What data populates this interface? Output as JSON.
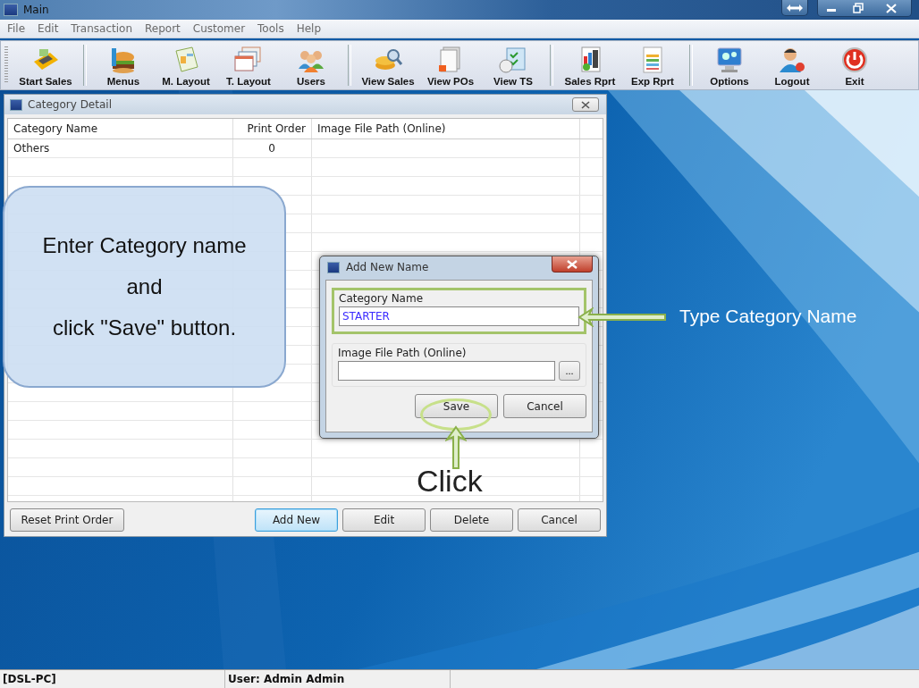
{
  "window": {
    "title": "Main"
  },
  "menu": [
    "File",
    "Edit",
    "Transaction",
    "Report",
    "Customer",
    "Tools",
    "Help"
  ],
  "toolbar": {
    "groups": [
      [
        "Start Sales"
      ],
      [
        "Menus",
        "M. Layout",
        "T. Layout",
        "Users"
      ],
      [
        "View Sales",
        "View POs",
        "View TS"
      ],
      [
        "Sales Rprt",
        "Exp Rprt"
      ],
      [
        "Options",
        "Logout",
        "Exit"
      ]
    ]
  },
  "category_window": {
    "title": "Category Detail",
    "table": {
      "columns": [
        "Category Name",
        "Print Order",
        "Image File Path (Online)"
      ],
      "rows": [
        {
          "category_name": "Others",
          "print_order": "0"
        }
      ]
    },
    "buttons": [
      {
        "label": "Reset Print Order",
        "focused": false
      },
      {
        "label": "Add New",
        "focused": true
      },
      {
        "label": "Edit",
        "focused": false
      },
      {
        "label": "Delete",
        "focused": false
      },
      {
        "label": "Cancel",
        "focused": false
      }
    ]
  },
  "dialog": {
    "title": "Add New Name",
    "fields": [
      {
        "label": "Category Name",
        "value": "STARTER",
        "highlighted": true
      },
      {
        "label": "Image File Path (Online)",
        "browse": "..."
      }
    ],
    "buttons": [
      {
        "label": "Save",
        "highlighted": true
      },
      {
        "label": "Cancel",
        "highlighted": false
      }
    ]
  },
  "annotations": {
    "callout": [
      "Enter Category name",
      "and",
      "click \"Save\" button."
    ],
    "field_hint": "Type Category Name",
    "click_hint": "Click"
  },
  "status_bar": [
    "[DSL-PC]",
    "User: Admin Admin"
  ]
}
